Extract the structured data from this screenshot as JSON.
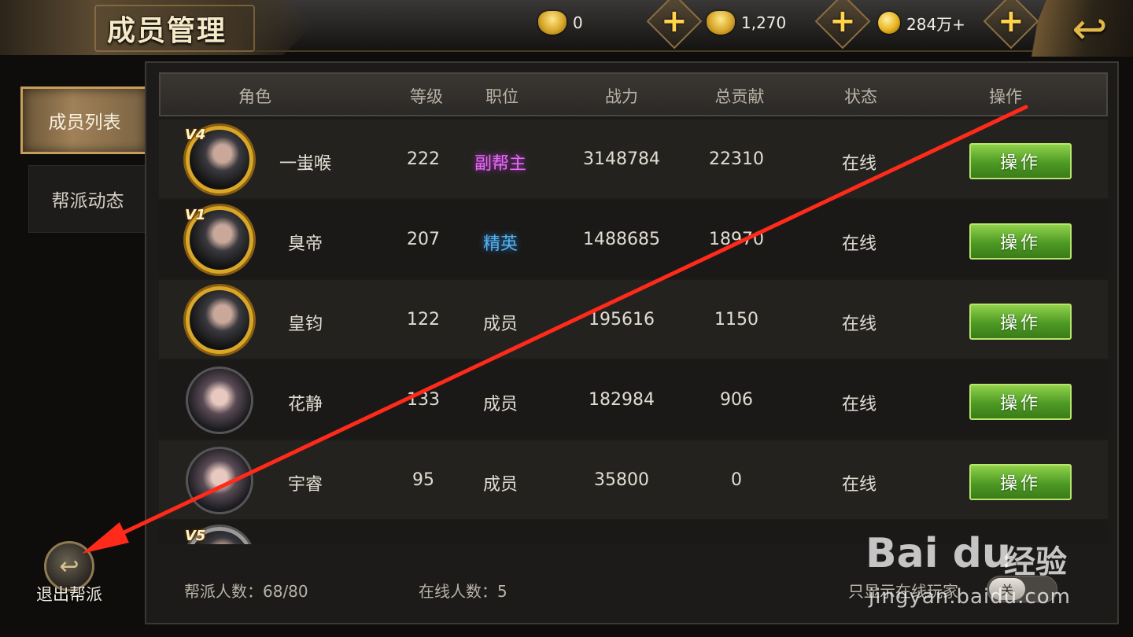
{
  "header": {
    "title": "成员管理",
    "currencies": [
      {
        "icon": "gold-ingot-icon",
        "value": "0"
      },
      {
        "icon": "bound-gold-icon",
        "value": "1,270"
      },
      {
        "icon": "copper-coin-icon",
        "value": "284万+"
      }
    ],
    "back_icon": "return-arrow-icon"
  },
  "sidebar": {
    "tabs": [
      {
        "label": "成员列表",
        "active": true
      },
      {
        "label": "帮派动态",
        "active": false
      }
    ]
  },
  "table": {
    "columns": [
      "角色",
      "等级",
      "职位",
      "战力",
      "总贡献",
      "状态",
      "操作"
    ],
    "rows": [
      {
        "name": "一蚩喉",
        "vip": "V4",
        "level": "222",
        "position": "副帮主",
        "power": "3148784",
        "contribution": "22310",
        "status": "在线",
        "action": "操作"
      },
      {
        "name": "臭帝",
        "vip": "V1",
        "level": "207",
        "position": "精英",
        "power": "1488685",
        "contribution": "18970",
        "status": "在线",
        "action": "操作"
      },
      {
        "name": "皇钧",
        "vip": "",
        "level": "122",
        "position": "成员",
        "power": "195616",
        "contribution": "1150",
        "status": "在线",
        "action": "操作"
      },
      {
        "name": "花静",
        "vip": "",
        "level": "133",
        "position": "成员",
        "power": "182984",
        "contribution": "906",
        "status": "在线",
        "action": "操作"
      },
      {
        "name": "宇睿",
        "vip": "",
        "level": "95",
        "position": "成员",
        "power": "35800",
        "contribution": "0",
        "status": "在线",
        "action": "操作"
      },
      {
        "name": "",
        "vip": "V5",
        "level": "",
        "position": "",
        "power": "",
        "contribution": "",
        "status": "",
        "action": ""
      }
    ]
  },
  "footer": {
    "member_count_label": "帮派人数：68/80",
    "online_count_label": "在线人数：5",
    "online_only_label": "只显示在线玩家",
    "toggle_state": "关"
  },
  "leave": {
    "label": "退出帮派"
  },
  "annotation": {
    "color": "#ff2a1a"
  },
  "watermark": {
    "logo": "Bai du",
    "cn": "经验",
    "url": "jingyan.baidu.com"
  }
}
